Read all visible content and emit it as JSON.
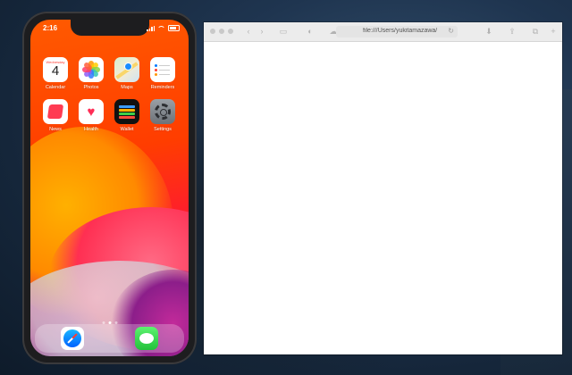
{
  "phone": {
    "status_time": "2:16",
    "apps": [
      {
        "label": "Calendar",
        "icon": "calendar-icon",
        "day": "Wednesday",
        "date": "4"
      },
      {
        "label": "Photos",
        "icon": "photos-icon"
      },
      {
        "label": "Maps",
        "icon": "maps-icon"
      },
      {
        "label": "Reminders",
        "icon": "reminders-icon"
      },
      {
        "label": "News",
        "icon": "news-icon"
      },
      {
        "label": "Health",
        "icon": "health-icon",
        "glyph": "♥"
      },
      {
        "label": "Wallet",
        "icon": "wallet-icon"
      },
      {
        "label": "Settings",
        "icon": "settings-icon"
      }
    ],
    "dock": [
      {
        "name": "Safari",
        "icon": "safari-icon"
      },
      {
        "name": "Messages",
        "icon": "messages-icon"
      }
    ],
    "page_count": 3,
    "active_page": 1
  },
  "browser": {
    "address": "file:///Users/yukitamazawa/",
    "toolbar_icons": [
      "back-icon",
      "forward-icon",
      "sidebar-icon",
      "privacy-icon",
      "icloud-icon",
      "download-icon",
      "share-icon",
      "tabs-icon",
      "add-tab-icon"
    ]
  },
  "colors": {
    "wallpaper_top": "#ff5a00",
    "wallpaper_bottom": "#5a1b6e",
    "desktop": "#1f3550"
  }
}
